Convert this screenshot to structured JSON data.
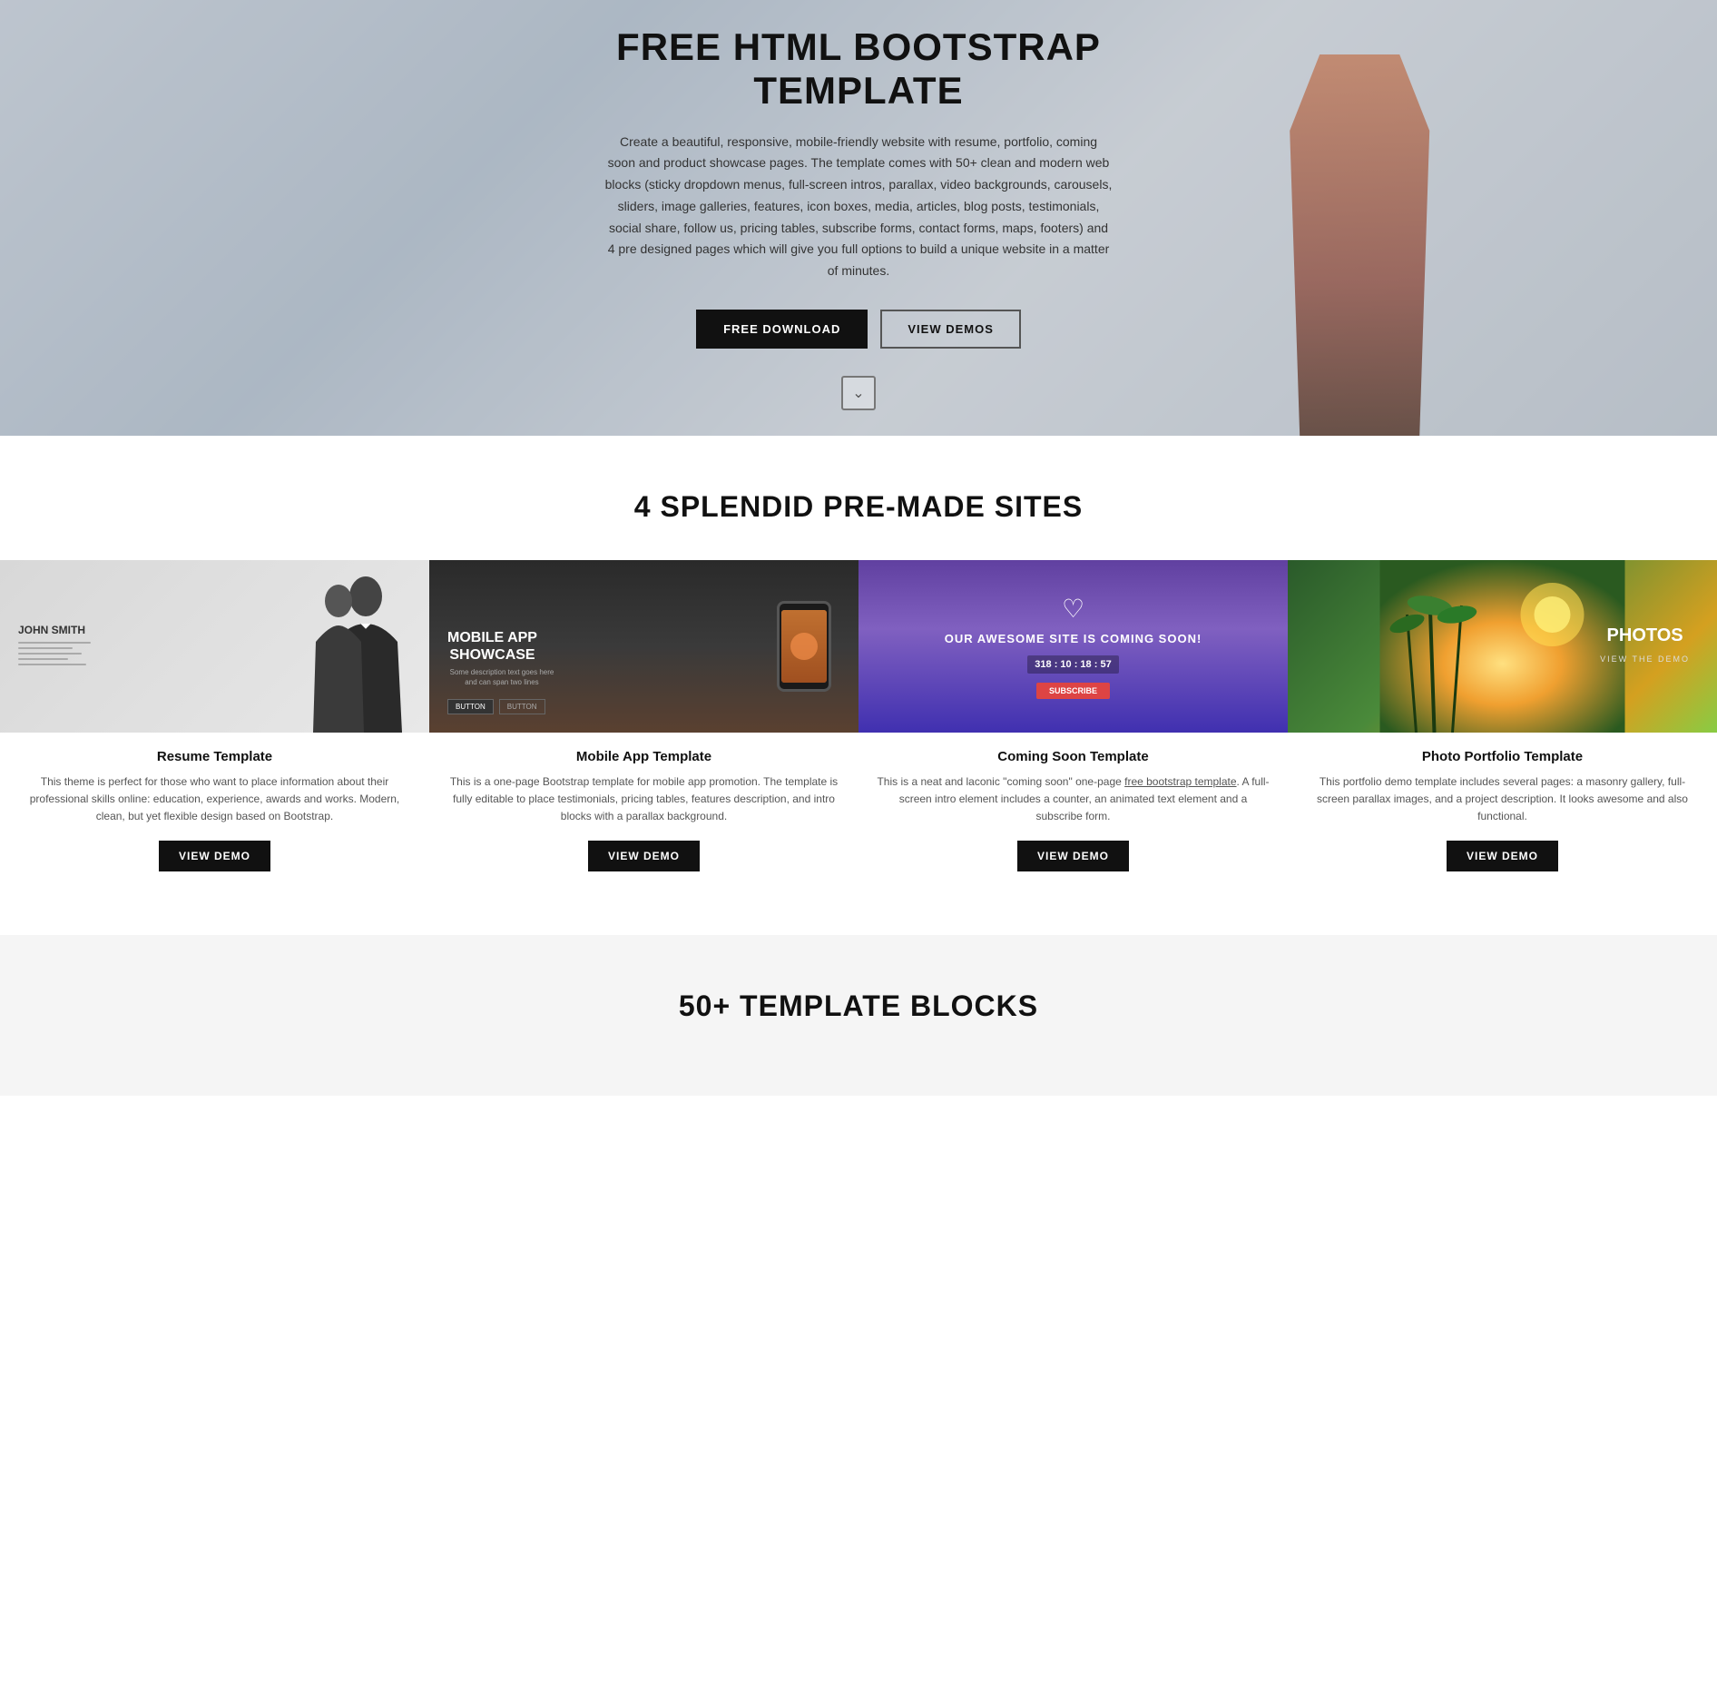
{
  "hero": {
    "title": "FREE HTML BOOTSTRAP TEMPLATE",
    "subtitle": "Create a beautiful, responsive, mobile-friendly website with resume, portfolio, coming soon and product showcase pages. The template comes with 50+ clean and modern web blocks (sticky dropdown menus, full-screen intros, parallax, video backgrounds, carousels, sliders, image galleries, features, icon boxes, media, articles, blog posts, testimonials, social share, follow us, pricing tables, subscribe forms, contact forms, maps, footers) and 4 pre designed pages which will give you full options to build a unique website in a matter of minutes.",
    "btn_download": "FREE DOWNLOAD",
    "btn_demos": "VIEW DEMOS",
    "scroll_icon": "⌄"
  },
  "sites_section": {
    "title": "4 SPLENDID PRE-MADE SITES",
    "cards": [
      {
        "id": "resume",
        "name": "Resume Template",
        "desc": "This theme is perfect for those who want to place information about their professional skills online: education, experience, awards and works. Modern, clean, but yet flexible design based on Bootstrap.",
        "btn": "VIEW DEMO",
        "person_name": "JOHN SMITH"
      },
      {
        "id": "mobile",
        "name": "Mobile App Template",
        "desc": "This is a one-page Bootstrap template for mobile app promotion. The template is fully editable to place testimonials, pricing tables, features description, and intro blocks with a parallax background.",
        "btn": "VIEW DEMO",
        "showcase_text": "MOBILE APP SHOWCASE"
      },
      {
        "id": "coming",
        "name": "Coming Soon Template",
        "desc": "This is a neat and laconic \"coming soon\" one-page free bootstrap template. A full-screen intro element includes a counter, an animated text element and a subscribe form.",
        "btn": "VIEW DEMO",
        "coming_text": "OUR AWESOME SITE IS COMING SOON!",
        "counter": "318 : 10 : 18 : 57"
      },
      {
        "id": "photos",
        "name": "Photo Portfolio Template",
        "desc": "This portfolio demo template includes several pages: a masonry gallery, full-screen parallax images, and a project description. It looks awesome and also functional.",
        "btn": "VIEW DEMO",
        "photos_label": "PHOTOS"
      }
    ]
  },
  "blocks_section": {
    "title": "50+ TEMPLATE BLOCKS"
  }
}
